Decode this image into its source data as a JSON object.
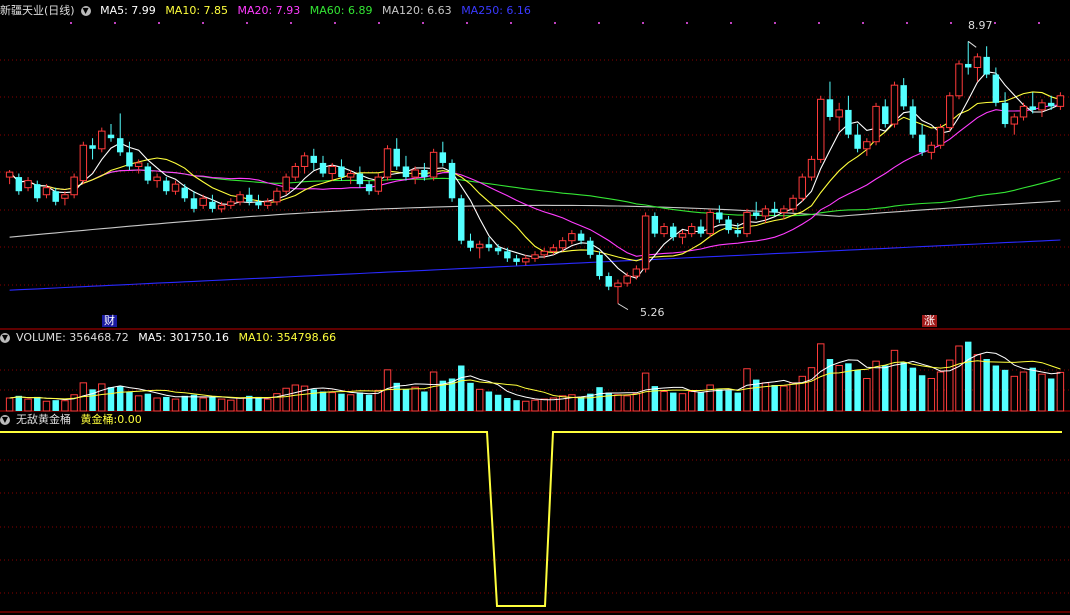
{
  "title": "新疆天业(日线)",
  "colors": {
    "up": "#ff3b3b",
    "down": "#54ffff",
    "ma5": "#ffffff",
    "ma10": "#ffff3c",
    "ma20": "#ff3cff",
    "ma60": "#34e534",
    "ma120": "#c8c8c8",
    "ma250": "#2a2aff",
    "grid": "#8a0000",
    "gold": "#ffff3c"
  },
  "main_legend": [
    {
      "label": "MA5: 7.99",
      "color": "#ffffff"
    },
    {
      "label": "MA10: 7.85",
      "color": "#ffff3c"
    },
    {
      "label": "MA20: 7.93",
      "color": "#ff3cff"
    },
    {
      "label": "MA60: 6.89",
      "color": "#34e534"
    },
    {
      "label": "MA120: 6.63",
      "color": "#c8c8c8"
    },
    {
      "label": "MA250: 6.16",
      "color": "#2a2aff"
    }
  ],
  "volume_legend": [
    {
      "label": "VOLUME: 356468.72",
      "color": "#cccccc"
    },
    {
      "label": "MA5: 301750.16",
      "color": "#ffffff"
    },
    {
      "label": "MA10: 354798.66",
      "color": "#ffff3c"
    }
  ],
  "indicator": {
    "name": "无敌黄金桶",
    "series_label": "黄金桶:",
    "value": "0.00"
  },
  "annotations": {
    "high_label": "8.97",
    "low_label": "5.26",
    "cai_tag": "财",
    "zhang_tag": "涨"
  },
  "chart_data": {
    "type": "candlestick",
    "price_range": [
      5.0,
      9.3
    ],
    "candles": [
      [
        7.05,
        7.15,
        6.95,
        7.12
      ],
      [
        7.05,
        7.1,
        6.8,
        6.85
      ],
      [
        6.9,
        7.05,
        6.85,
        7.0
      ],
      [
        6.95,
        7.0,
        6.7,
        6.75
      ],
      [
        6.8,
        6.95,
        6.75,
        6.9
      ],
      [
        6.85,
        6.9,
        6.65,
        6.7
      ],
      [
        6.75,
        6.85,
        6.65,
        6.8
      ],
      [
        6.8,
        7.1,
        6.75,
        7.05
      ],
      [
        7.0,
        7.55,
        6.95,
        7.5
      ],
      [
        7.5,
        7.6,
        7.3,
        7.45
      ],
      [
        7.45,
        7.75,
        7.4,
        7.7
      ],
      [
        7.65,
        7.8,
        7.55,
        7.6
      ],
      [
        7.6,
        7.95,
        7.35,
        7.4
      ],
      [
        7.4,
        7.55,
        7.15,
        7.2
      ],
      [
        7.2,
        7.3,
        7.1,
        7.25
      ],
      [
        7.2,
        7.25,
        6.95,
        7.0
      ],
      [
        7.0,
        7.1,
        6.9,
        7.05
      ],
      [
        7.0,
        7.05,
        6.8,
        6.85
      ],
      [
        6.85,
        7.0,
        6.8,
        6.95
      ],
      [
        6.9,
        6.95,
        6.7,
        6.75
      ],
      [
        6.75,
        6.85,
        6.55,
        6.6
      ],
      [
        6.65,
        6.8,
        6.6,
        6.75
      ],
      [
        6.7,
        6.8,
        6.55,
        6.6
      ],
      [
        6.6,
        6.7,
        6.55,
        6.65
      ],
      [
        6.65,
        6.75,
        6.6,
        6.7
      ],
      [
        6.7,
        6.85,
        6.65,
        6.8
      ],
      [
        6.8,
        6.9,
        6.65,
        6.7
      ],
      [
        6.7,
        6.8,
        6.6,
        6.65
      ],
      [
        6.65,
        6.75,
        6.6,
        6.7
      ],
      [
        6.7,
        6.9,
        6.65,
        6.85
      ],
      [
        6.85,
        7.1,
        6.8,
        7.05
      ],
      [
        7.05,
        7.25,
        7.0,
        7.2
      ],
      [
        7.2,
        7.4,
        7.1,
        7.35
      ],
      [
        7.35,
        7.45,
        7.15,
        7.25
      ],
      [
        7.25,
        7.35,
        7.05,
        7.1
      ],
      [
        7.1,
        7.25,
        7.0,
        7.2
      ],
      [
        7.2,
        7.3,
        7.0,
        7.05
      ],
      [
        7.05,
        7.15,
        6.95,
        7.1
      ],
      [
        7.1,
        7.2,
        6.9,
        6.95
      ],
      [
        6.95,
        7.0,
        6.8,
        6.85
      ],
      [
        6.85,
        7.1,
        6.8,
        7.05
      ],
      [
        7.05,
        7.5,
        7.0,
        7.45
      ],
      [
        7.45,
        7.6,
        7.15,
        7.2
      ],
      [
        7.2,
        7.35,
        7.0,
        7.05
      ],
      [
        7.05,
        7.2,
        6.95,
        7.15
      ],
      [
        7.15,
        7.25,
        7.0,
        7.05
      ],
      [
        7.05,
        7.45,
        7.0,
        7.4
      ],
      [
        7.4,
        7.55,
        7.2,
        7.25
      ],
      [
        7.25,
        7.3,
        6.7,
        6.75
      ],
      [
        6.75,
        6.8,
        6.1,
        6.15
      ],
      [
        6.15,
        6.25,
        6.0,
        6.05
      ],
      [
        6.05,
        6.15,
        5.9,
        6.1
      ],
      [
        6.1,
        6.2,
        6.0,
        6.05
      ],
      [
        6.05,
        6.1,
        5.95,
        6.0
      ],
      [
        6.0,
        6.05,
        5.85,
        5.9
      ],
      [
        5.9,
        5.95,
        5.8,
        5.85
      ],
      [
        5.85,
        5.95,
        5.8,
        5.9
      ],
      [
        5.9,
        6.0,
        5.85,
        5.95
      ],
      [
        5.95,
        6.05,
        5.9,
        6.0
      ],
      [
        6.0,
        6.1,
        5.95,
        6.05
      ],
      [
        6.05,
        6.2,
        6.0,
        6.15
      ],
      [
        6.15,
        6.3,
        6.1,
        6.25
      ],
      [
        6.25,
        6.3,
        6.1,
        6.15
      ],
      [
        6.15,
        6.2,
        5.9,
        5.95
      ],
      [
        5.95,
        6.0,
        5.6,
        5.65
      ],
      [
        5.65,
        5.7,
        5.45,
        5.5
      ],
      [
        5.5,
        5.6,
        5.26,
        5.55
      ],
      [
        5.55,
        5.7,
        5.5,
        5.65
      ],
      [
        5.65,
        5.8,
        5.6,
        5.75
      ],
      [
        5.75,
        6.55,
        5.7,
        6.5
      ],
      [
        6.5,
        6.55,
        6.2,
        6.25
      ],
      [
        6.25,
        6.4,
        6.2,
        6.35
      ],
      [
        6.35,
        6.4,
        6.15,
        6.2
      ],
      [
        6.2,
        6.3,
        6.1,
        6.25
      ],
      [
        6.25,
        6.4,
        6.2,
        6.35
      ],
      [
        6.35,
        6.45,
        6.2,
        6.25
      ],
      [
        6.25,
        6.6,
        6.2,
        6.55
      ],
      [
        6.55,
        6.65,
        6.4,
        6.45
      ],
      [
        6.45,
        6.5,
        6.25,
        6.3
      ],
      [
        6.3,
        6.4,
        6.2,
        6.25
      ],
      [
        6.25,
        6.6,
        6.2,
        6.55
      ],
      [
        6.55,
        6.7,
        6.45,
        6.5
      ],
      [
        6.5,
        6.65,
        6.4,
        6.6
      ],
      [
        6.6,
        6.7,
        6.5,
        6.55
      ],
      [
        6.55,
        6.65,
        6.45,
        6.6
      ],
      [
        6.6,
        6.8,
        6.55,
        6.75
      ],
      [
        6.75,
        7.1,
        6.7,
        7.05
      ],
      [
        7.05,
        7.35,
        7.0,
        7.3
      ],
      [
        7.3,
        8.2,
        7.25,
        8.15
      ],
      [
        8.15,
        8.4,
        7.85,
        7.9
      ],
      [
        7.9,
        8.1,
        7.7,
        8.0
      ],
      [
        8.0,
        8.2,
        7.6,
        7.65
      ],
      [
        7.65,
        7.8,
        7.4,
        7.45
      ],
      [
        7.45,
        7.6,
        7.35,
        7.55
      ],
      [
        7.55,
        8.1,
        7.5,
        8.05
      ],
      [
        8.05,
        8.15,
        7.75,
        7.8
      ],
      [
        7.8,
        8.4,
        7.75,
        8.35
      ],
      [
        8.35,
        8.45,
        8.0,
        8.05
      ],
      [
        8.05,
        8.15,
        7.6,
        7.65
      ],
      [
        7.65,
        7.8,
        7.35,
        7.4
      ],
      [
        7.4,
        7.55,
        7.3,
        7.5
      ],
      [
        7.5,
        7.8,
        7.45,
        7.75
      ],
      [
        7.75,
        8.25,
        7.7,
        8.2
      ],
      [
        8.2,
        8.7,
        8.15,
        8.65
      ],
      [
        8.65,
        8.97,
        8.5,
        8.6
      ],
      [
        8.6,
        8.8,
        8.4,
        8.75
      ],
      [
        8.75,
        8.9,
        8.45,
        8.5
      ],
      [
        8.5,
        8.6,
        8.05,
        8.1
      ],
      [
        8.1,
        8.25,
        7.75,
        7.8
      ],
      [
        7.8,
        7.95,
        7.65,
        7.9
      ],
      [
        7.9,
        8.1,
        7.85,
        8.05
      ],
      [
        8.05,
        8.25,
        7.95,
        8.0
      ],
      [
        8.0,
        8.15,
        7.9,
        8.1
      ],
      [
        8.1,
        8.2,
        8.0,
        8.05
      ],
      [
        8.05,
        8.25,
        8.0,
        8.2
      ]
    ],
    "volume_range": [
      0,
      600000
    ],
    "volumes": [
      120000,
      140000,
      110000,
      130000,
      90000,
      100000,
      95000,
      150000,
      260000,
      200000,
      250000,
      220000,
      230000,
      180000,
      140000,
      160000,
      120000,
      130000,
      110000,
      140000,
      150000,
      120000,
      130000,
      110000,
      100000,
      120000,
      140000,
      130000,
      110000,
      160000,
      210000,
      240000,
      230000,
      200000,
      180000,
      170000,
      160000,
      150000,
      170000,
      150000,
      190000,
      380000,
      260000,
      200000,
      220000,
      180000,
      360000,
      280000,
      300000,
      420000,
      260000,
      200000,
      180000,
      150000,
      120000,
      100000,
      90000,
      100000,
      110000,
      120000,
      140000,
      150000,
      130000,
      160000,
      220000,
      170000,
      150000,
      140000,
      160000,
      350000,
      230000,
      180000,
      170000,
      160000,
      180000,
      170000,
      240000,
      200000,
      190000,
      170000,
      390000,
      290000,
      260000,
      240000,
      230000,
      260000,
      320000,
      400000,
      620000,
      480000,
      420000,
      440000,
      380000,
      300000,
      460000,
      420000,
      560000,
      450000,
      400000,
      330000,
      300000,
      360000,
      470000,
      600000,
      640000,
      520000,
      480000,
      420000,
      380000,
      320000,
      360000,
      400000,
      340000,
      300000,
      356468
    ],
    "indicator_range": [
      -1,
      1
    ],
    "indicator_values_note": ""
  }
}
